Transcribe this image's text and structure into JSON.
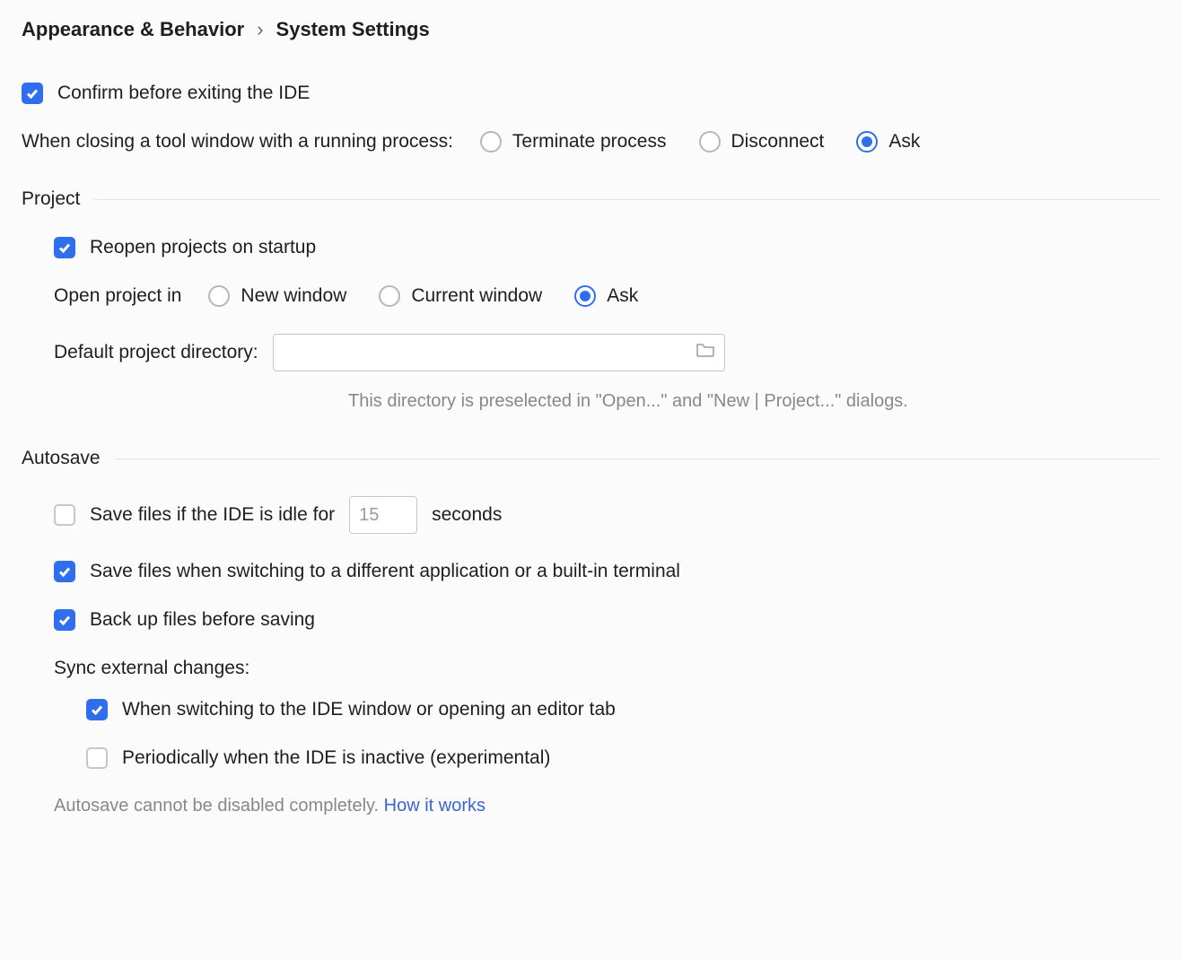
{
  "breadcrumb": {
    "parent": "Appearance & Behavior",
    "sep": "›",
    "current": "System Settings"
  },
  "top": {
    "confirm_exit": "Confirm before exiting the IDE",
    "closing_tool_window_label": "When closing a tool window with a running process:",
    "radios": {
      "terminate": "Terminate process",
      "disconnect": "Disconnect",
      "ask": "Ask"
    }
  },
  "project": {
    "title": "Project",
    "reopen": "Reopen projects on startup",
    "open_in_label": "Open project in",
    "radios": {
      "new_window": "New window",
      "current_window": "Current window",
      "ask": "Ask"
    },
    "default_dir_label": "Default project directory:",
    "default_dir_value": "",
    "default_dir_hint": "This directory is preselected in \"Open...\" and \"New | Project...\" dialogs."
  },
  "autosave": {
    "title": "Autosave",
    "idle_prefix": "Save files if the IDE is idle for",
    "idle_value": "15",
    "idle_suffix": "seconds",
    "switch_app": "Save files when switching to a different application or a built-in terminal",
    "backup": "Back up files before saving",
    "sync_label": "Sync external changes:",
    "sync_switch": "When switching to the IDE window or opening an editor tab",
    "sync_periodic": "Periodically when the IDE is inactive (experimental)",
    "footnote_text": "Autosave cannot be disabled completely. ",
    "footnote_link": "How it works"
  }
}
